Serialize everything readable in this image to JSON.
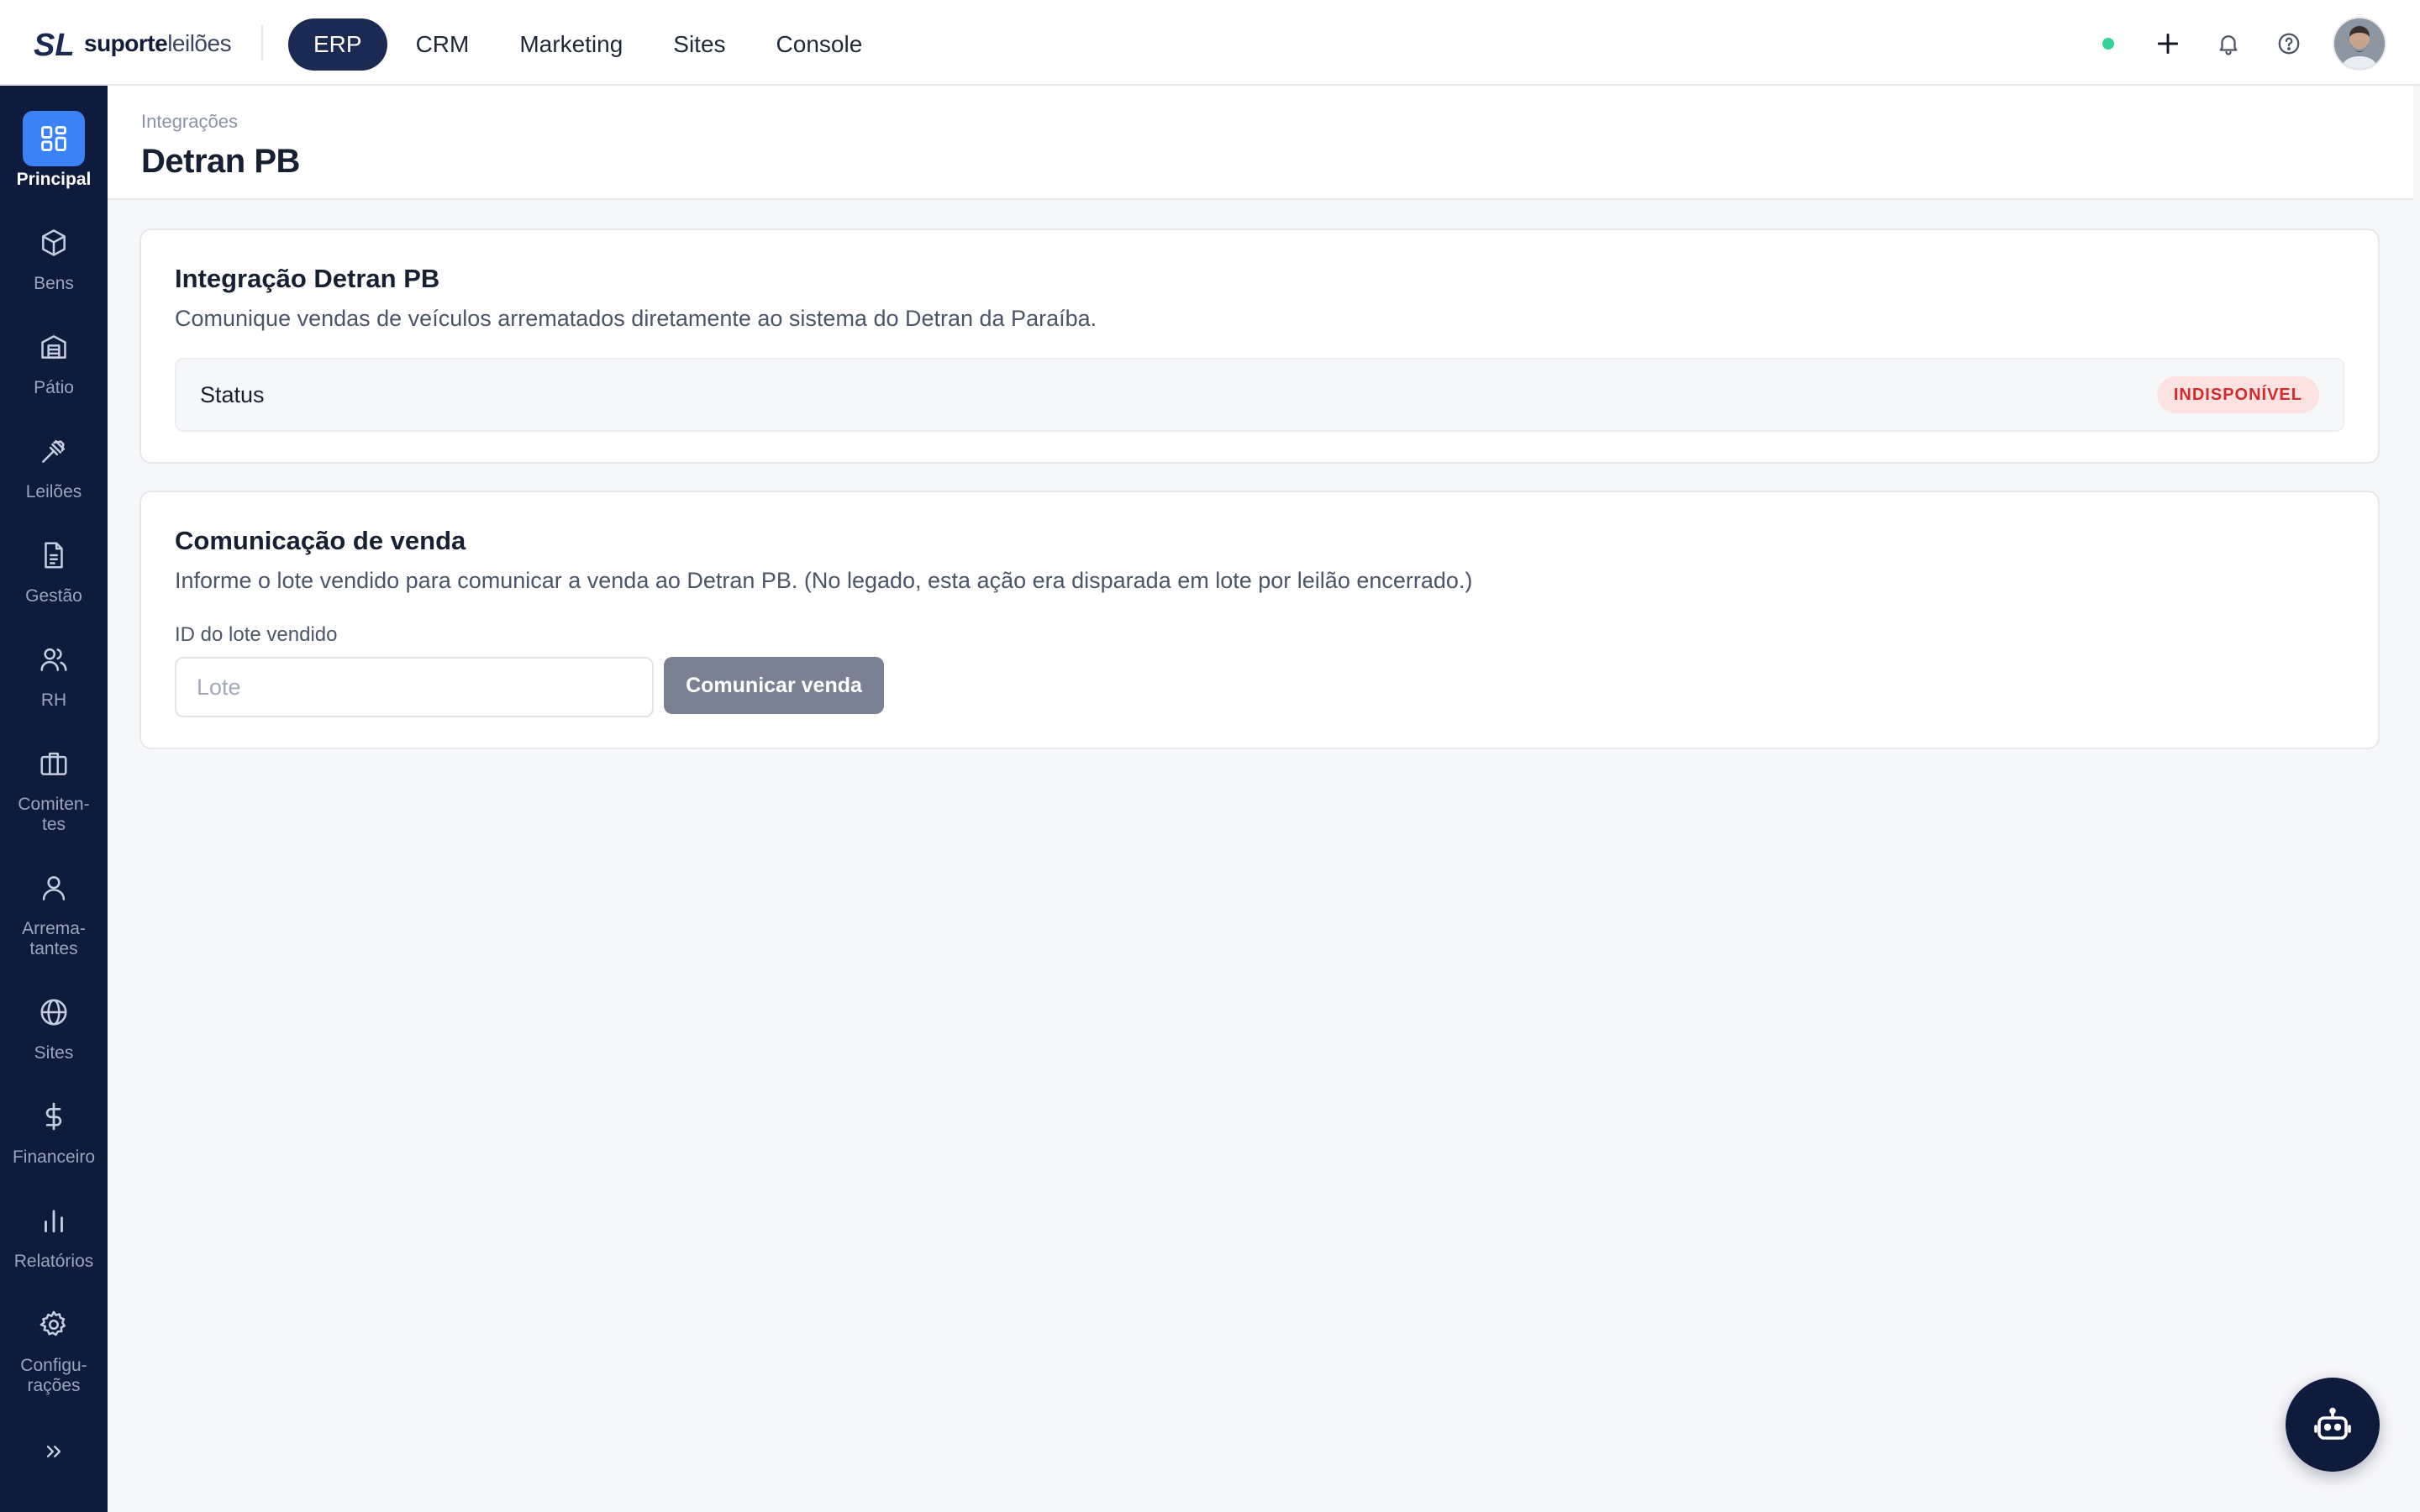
{
  "brand": {
    "name_bold": "suporte",
    "name_regular": "leilões"
  },
  "topnav": {
    "items": [
      {
        "label": "ERP",
        "active": true
      },
      {
        "label": "CRM",
        "active": false
      },
      {
        "label": "Marketing",
        "active": false
      },
      {
        "label": "Sites",
        "active": false
      },
      {
        "label": "Console",
        "active": false
      }
    ]
  },
  "top_actions": {
    "status_color": "#34d399",
    "icons": [
      "plus-icon",
      "bell-icon",
      "help-icon"
    ]
  },
  "sidebar": {
    "items": [
      {
        "label": "Principal",
        "icon": "grid-icon",
        "active": true
      },
      {
        "label": "Bens",
        "icon": "box-icon",
        "active": false
      },
      {
        "label": "Pátio",
        "icon": "warehouse-icon",
        "active": false
      },
      {
        "label": "Leilões",
        "icon": "gavel-icon",
        "active": false
      },
      {
        "label": "Gestão",
        "icon": "document-icon",
        "active": false
      },
      {
        "label": "RH",
        "icon": "users-icon",
        "active": false
      },
      {
        "label": "Comiten-\ntes",
        "icon": "briefcase-icon",
        "active": false
      },
      {
        "label": "Arrema-\ntantes",
        "icon": "user-icon",
        "active": false
      },
      {
        "label": "Sites",
        "icon": "globe-icon",
        "active": false
      },
      {
        "label": "Financeiro",
        "icon": "dollar-icon",
        "active": false
      },
      {
        "label": "Relatórios",
        "icon": "bar-chart-icon",
        "active": false
      },
      {
        "label": "Configu-\nrações",
        "icon": "gear-icon",
        "active": false
      }
    ],
    "collapse_icon": "chevrons-right-icon"
  },
  "page": {
    "breadcrumb": "Integrações",
    "title": "Detran PB"
  },
  "integration_card": {
    "title": "Integração Detran PB",
    "description": "Comunique vendas de veículos arrematados diretamente ao sistema do Detran da Paraíba.",
    "status_label": "Status",
    "status_value": "INDISPONÍVEL",
    "status_color": "#d12b2b"
  },
  "sale_card": {
    "title": "Comunicação de venda",
    "description": "Informe o lote vendido para comunicar a venda ao Detran PB. (No legado, esta ação era disparada em lote por leilão encerrado.)",
    "field_label": "ID do lote vendido",
    "input_placeholder": "Lote",
    "input_value": "",
    "button_label": "Comunicar venda"
  },
  "assistant": {
    "icon": "bot-icon"
  }
}
